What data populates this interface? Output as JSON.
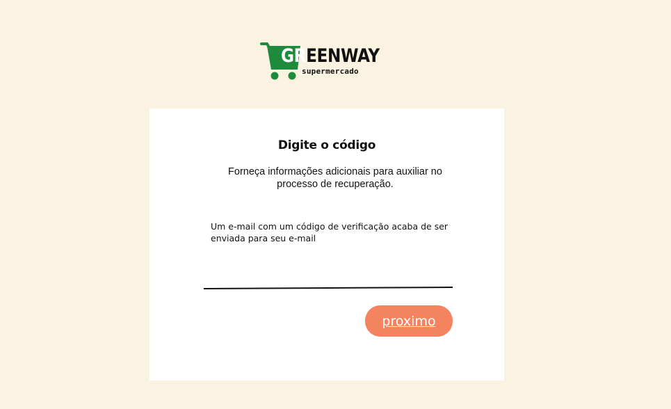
{
  "brand": {
    "logo_first": "G",
    "logo_second": "R",
    "logo_rest": "EENWAY",
    "logo_sub": "supermercado",
    "green": "#1e8a3c"
  },
  "card": {
    "title": "Digite o código",
    "subtitle": "Forneça informações adicionais para auxiliar no processo de recuperação.",
    "message": "Um e-mail com um código de verificação acaba de ser enviada para seu e-mail",
    "code_value": "",
    "next_label": "proximo",
    "accent": "#f4845f"
  },
  "background": "#faf3e1"
}
